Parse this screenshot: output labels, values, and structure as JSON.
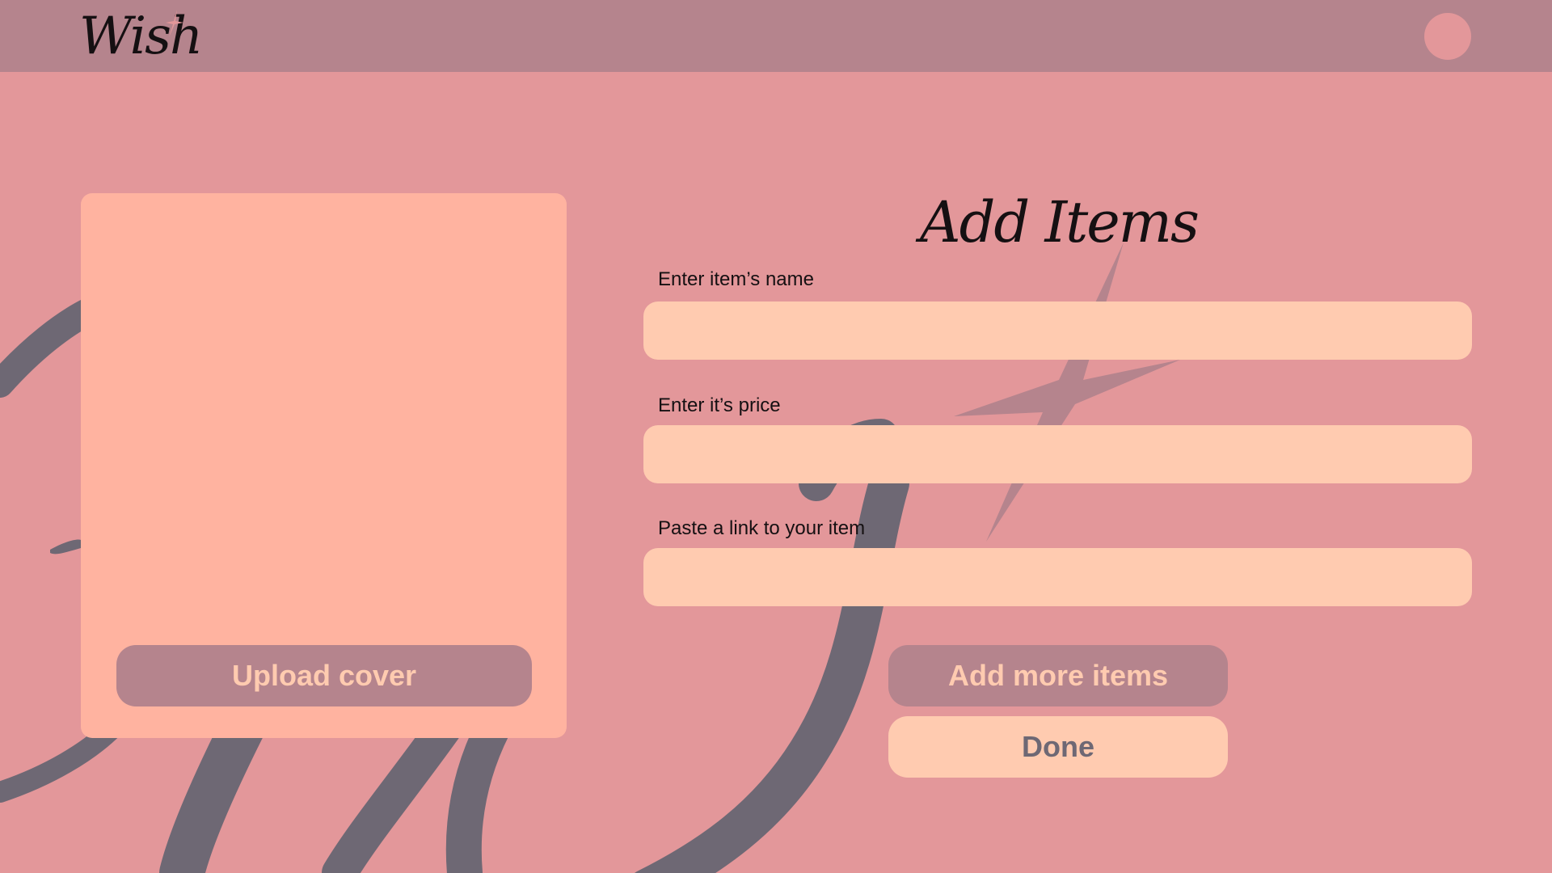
{
  "header": {
    "logo_text": "Wish"
  },
  "cover": {
    "upload_label": "Upload cover"
  },
  "form": {
    "title": "Add Items",
    "fields": [
      {
        "label": "Enter item’s name",
        "value": "",
        "placeholder": ""
      },
      {
        "label": "Enter it’s price",
        "value": "",
        "placeholder": ""
      },
      {
        "label": "Paste a link to your item",
        "value": "",
        "placeholder": ""
      }
    ],
    "add_more_label": "Add more items",
    "done_label": "Done"
  },
  "colors": {
    "background": "#e3979a",
    "topbar": "#b5848d",
    "cover_card": "#ffb3a0",
    "input": "#ffcbb0",
    "button_dark": "#b5848d",
    "button_light": "#ffcbb0",
    "swirl": "#6e6874",
    "text": "#151012"
  }
}
